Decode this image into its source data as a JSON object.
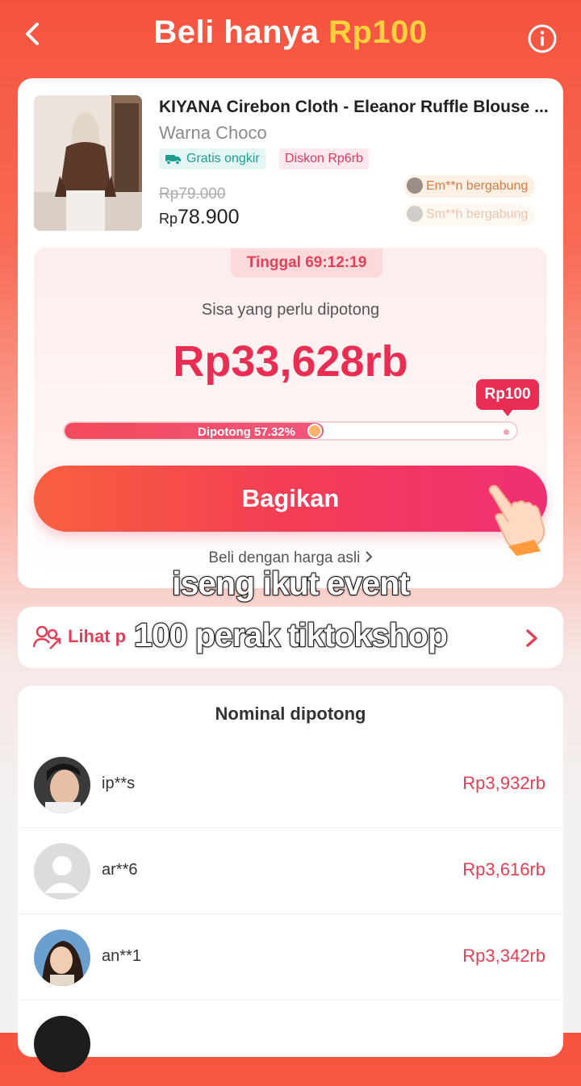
{
  "header": {
    "title_prefix": "Beli hanya",
    "title_highlight": "Rp100",
    "back_icon": "chevron-left-icon",
    "info_icon": "info-icon"
  },
  "product": {
    "name": "KIYANA Cirebon Cloth - Eleanor Ruffle Blouse ...",
    "variant": "Warna  Choco",
    "tags": {
      "shipping": "Gratis ongkir",
      "discount": "Diskon Rp6rb"
    },
    "old_price": "Rp79.000",
    "price_prefix": "Rp",
    "price_value": "78.900",
    "joined": [
      "Em**n bergabung",
      "Sm**h bergabung"
    ]
  },
  "cut_panel": {
    "timer": "Tinggal 69:12:19",
    "remaining_label": "Sisa yang perlu dipotong",
    "remaining_amount": "Rp33,628rb",
    "target": "Rp100",
    "progress_label": "Dipotong 57.32%",
    "progress_fraction": 0.5732
  },
  "actions": {
    "share": "Bagikan",
    "buy_original": "Beli dengan harga asli"
  },
  "friends": {
    "label": "Lihat p"
  },
  "list": {
    "title": "Nominal dipotong",
    "rows": [
      {
        "name": "ip**s",
        "amount": "Rp3,932rb"
      },
      {
        "name": "ar**6",
        "amount": "Rp3,616rb"
      },
      {
        "name": "an**1",
        "amount": "Rp3,342rb"
      }
    ]
  },
  "overlay": {
    "line1": "iseng ikut event",
    "line2": "100 perak tiktokshop"
  },
  "colors": {
    "accent": "#ea2d52",
    "header_bg": "#f5533f",
    "highlight": "#ffd23d",
    "tag_ship": "#1d9e90"
  }
}
